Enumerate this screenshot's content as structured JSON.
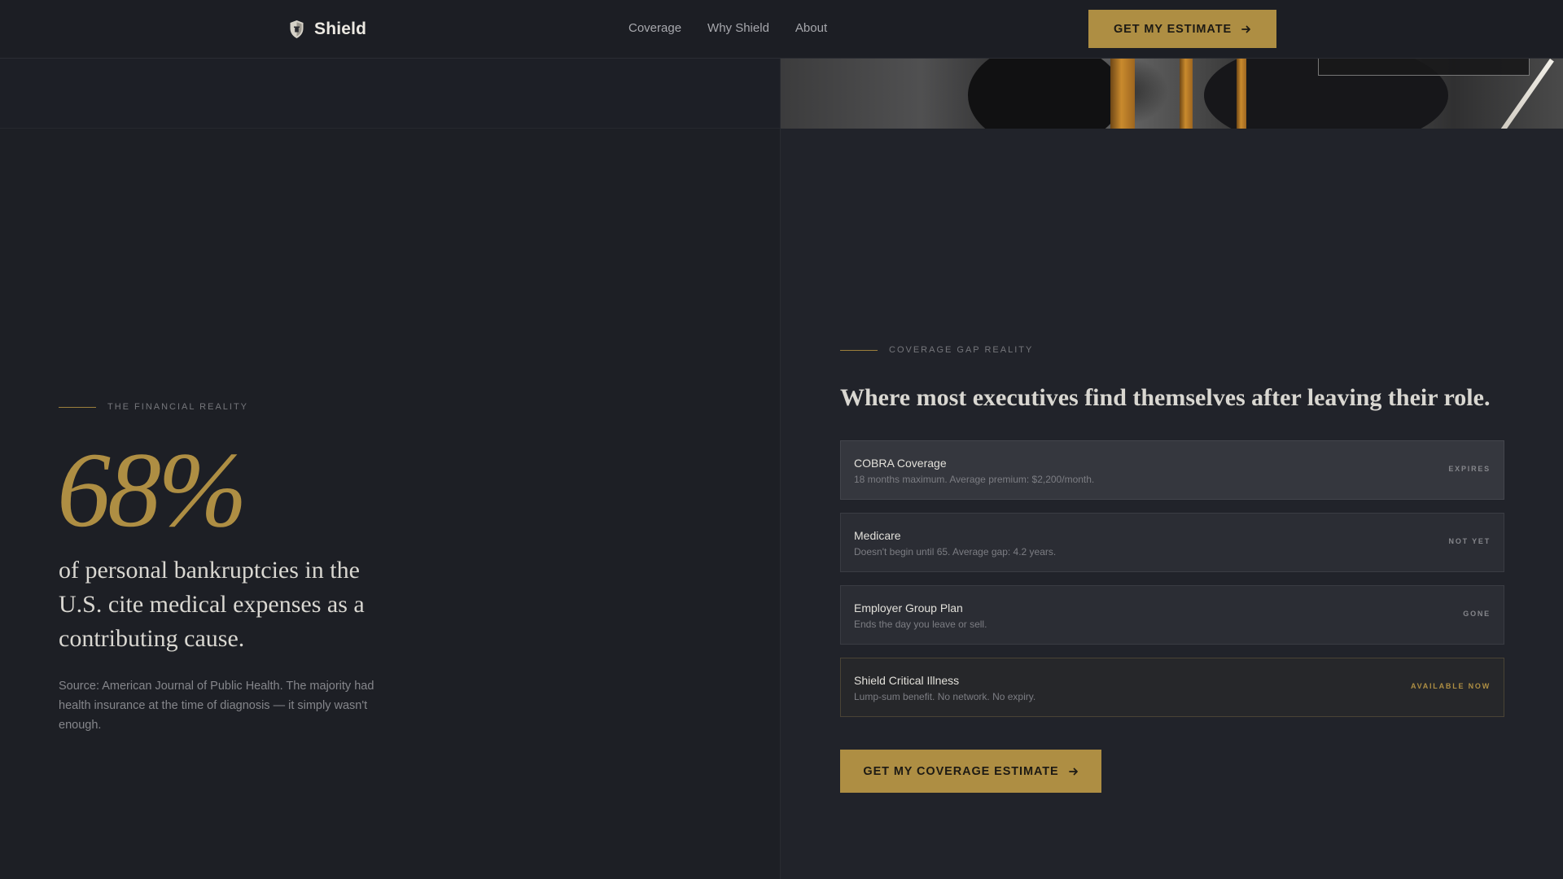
{
  "nav": {
    "brand": "Shield",
    "links": [
      "Coverage",
      "Why Shield",
      "About"
    ],
    "cta_label": "GET MY ESTIMATE",
    "cta_icon": "arrow-right-icon"
  },
  "left": {
    "eyebrow": "THE FINANCIAL REALITY",
    "stat": "68%",
    "stat_description": "of personal bankruptcies in the U.S. cite medical expenses as a contributing cause.",
    "source": "Source: American Journal of Public Health. The majority had health insurance at the time of diagnosis — it simply wasn't enough."
  },
  "right": {
    "eyebrow": "COVERAGE GAP REALITY",
    "heading": "Where most executives find themselves after leaving their role.",
    "options": [
      {
        "title": "COBRA Coverage",
        "subtitle": "18 months maximum. Average premium: $2,200/month.",
        "status": "EXPIRES"
      },
      {
        "title": "Medicare",
        "subtitle": "Doesn't begin until 65. Average gap: 4.2 years.",
        "status": "NOT YET"
      },
      {
        "title": "Employer Group Plan",
        "subtitle": "Ends the day you leave or sell.",
        "status": "GONE"
      },
      {
        "title": "Shield Critical Illness",
        "subtitle": "Lump-sum benefit. No network. No expiry.",
        "status": "AVAILABLE NOW"
      }
    ],
    "cta_label": "GET MY COVERAGE ESTIMATE",
    "cta_icon": "arrow-right-icon"
  },
  "colors": {
    "accent": "#ae8e43",
    "background": "#1d1f25",
    "panel": "#21232a"
  }
}
